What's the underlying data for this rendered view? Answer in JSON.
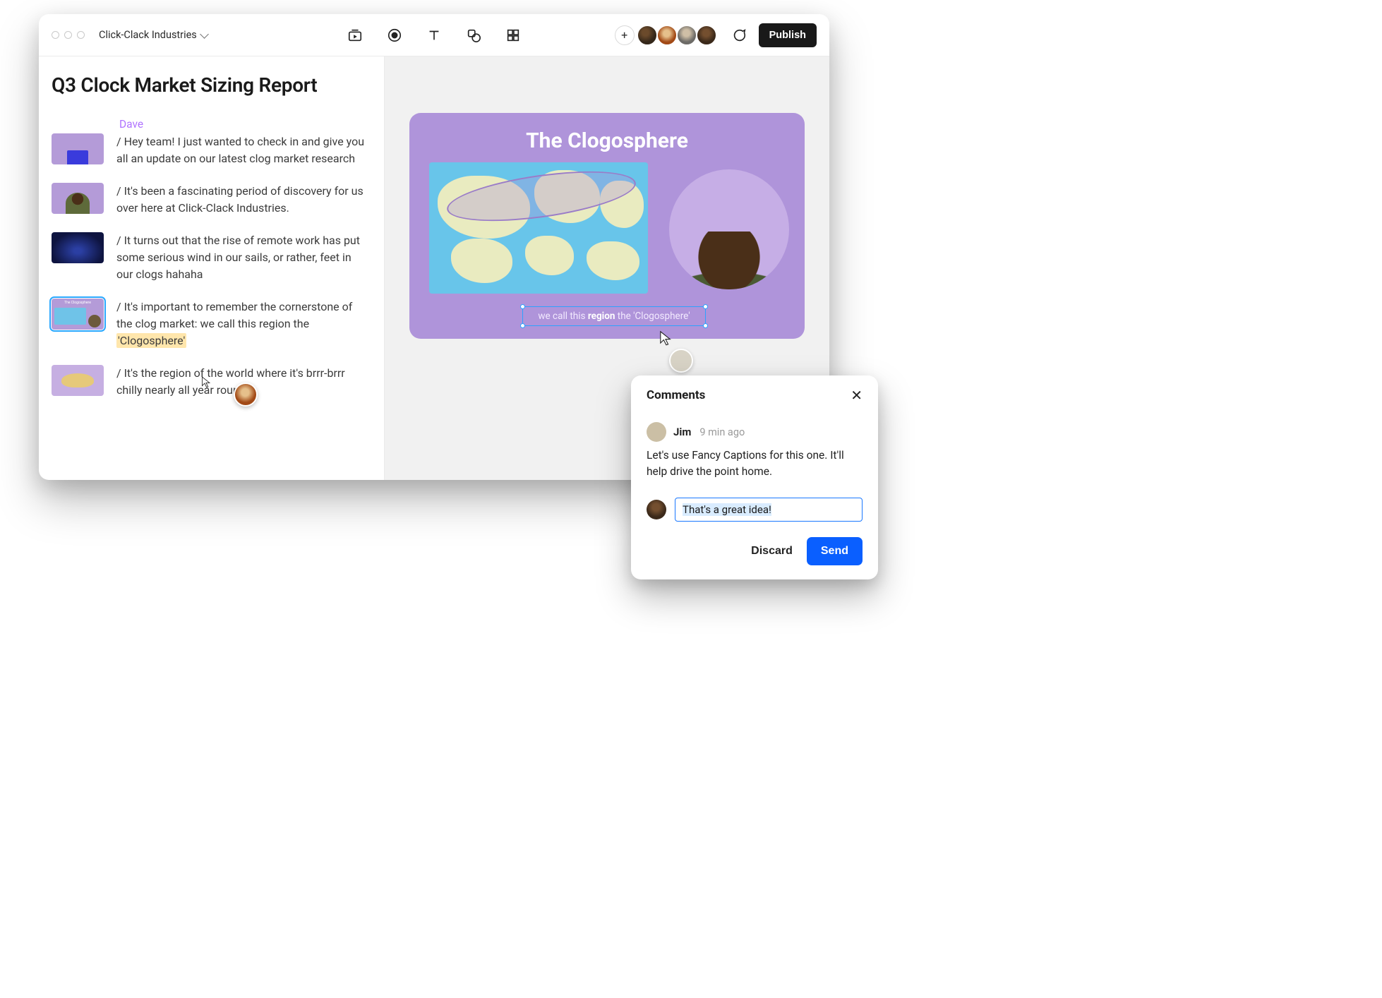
{
  "project_name": "Click-Clack Industries",
  "publish_label": "Publish",
  "document": {
    "title": "Q3 Clock Market Sizing Report",
    "author": "Dave",
    "segments": [
      "/ Hey team! I just wanted to check in and give you all an update on our latest clog market research",
      "/ It's been a fascinating period of discovery for us over here at Click-Clack Industries.",
      "/ It turns out that the rise of remote work has put some serious wind in our sails, or rather, feet in our clogs hahaha",
      "/ It's important to remember the cornerstone of the clog market: we call this region the ",
      "/ It's the region of the world where it's brrr-brrr chilly nearly all year round."
    ],
    "highlight": "'Clogosphere'"
  },
  "slide": {
    "title": "The Clogosphere",
    "caption_pre": "we call this ",
    "caption_bold": "region",
    "caption_post": " the 'Clogosphere'"
  },
  "comments": {
    "heading": "Comments",
    "author": "Jim",
    "time": "9 min ago",
    "body": "Let's use Fancy Captions for this one. It'll help drive the point home.",
    "reply_value": "That's a great idea!",
    "discard_label": "Discard",
    "send_label": "Send"
  }
}
